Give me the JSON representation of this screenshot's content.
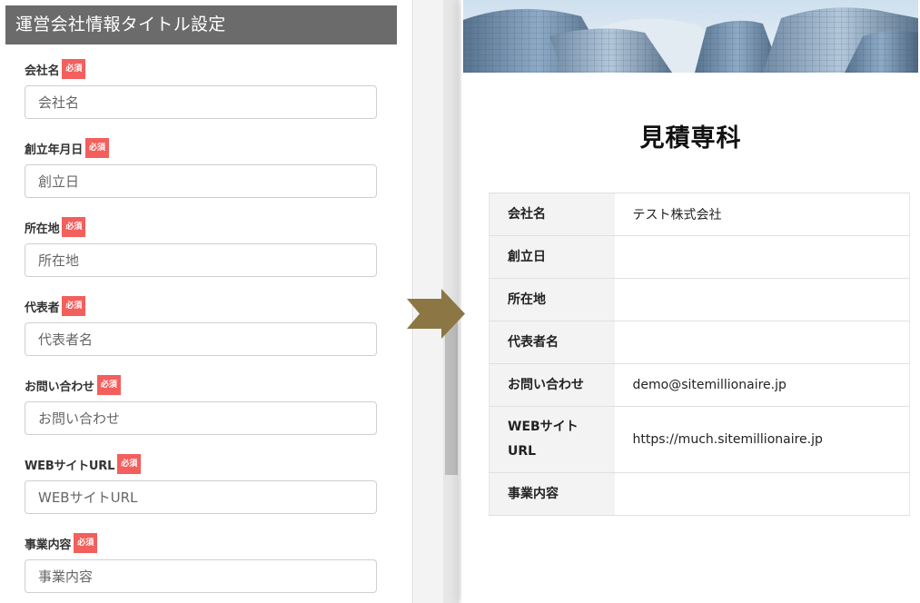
{
  "panel": {
    "title": "運営会社情報タイトル設定",
    "required_badge": "必須",
    "fields": [
      {
        "label": "会社名",
        "placeholder": "会社名",
        "value": ""
      },
      {
        "label": "創立年月日",
        "placeholder": "創立日",
        "value": ""
      },
      {
        "label": "所在地",
        "placeholder": "所在地",
        "value": ""
      },
      {
        "label": "代表者",
        "placeholder": "代表者名",
        "value": ""
      },
      {
        "label": "お問い合わせ",
        "placeholder": "お問い合わせ",
        "value": ""
      },
      {
        "label": "WEBサイトURL",
        "placeholder": "WEBサイトURL",
        "value": ""
      },
      {
        "label": "事業内容",
        "placeholder": "事業内容",
        "value": ""
      }
    ]
  },
  "preview": {
    "title": "見積専科",
    "rows": [
      {
        "label": "会社名",
        "value": "テスト株式会社"
      },
      {
        "label": "創立日",
        "value": ""
      },
      {
        "label": "所在地",
        "value": ""
      },
      {
        "label": "代表者名",
        "value": ""
      },
      {
        "label": "お問い合わせ",
        "value": "demo@sitemillionaire.jp"
      },
      {
        "label": "WEBサイト\nURL",
        "value": "https://much.sitemillionaire.jp"
      },
      {
        "label": "事業内容",
        "value": ""
      }
    ]
  },
  "colors": {
    "header_bg": "#6b6b6b",
    "required_badge": "#f25f5c",
    "arrow": "#8c7744",
    "table_label_bg": "#f3f3f3"
  },
  "icons": {
    "arrow": "right-arrow-icon"
  }
}
